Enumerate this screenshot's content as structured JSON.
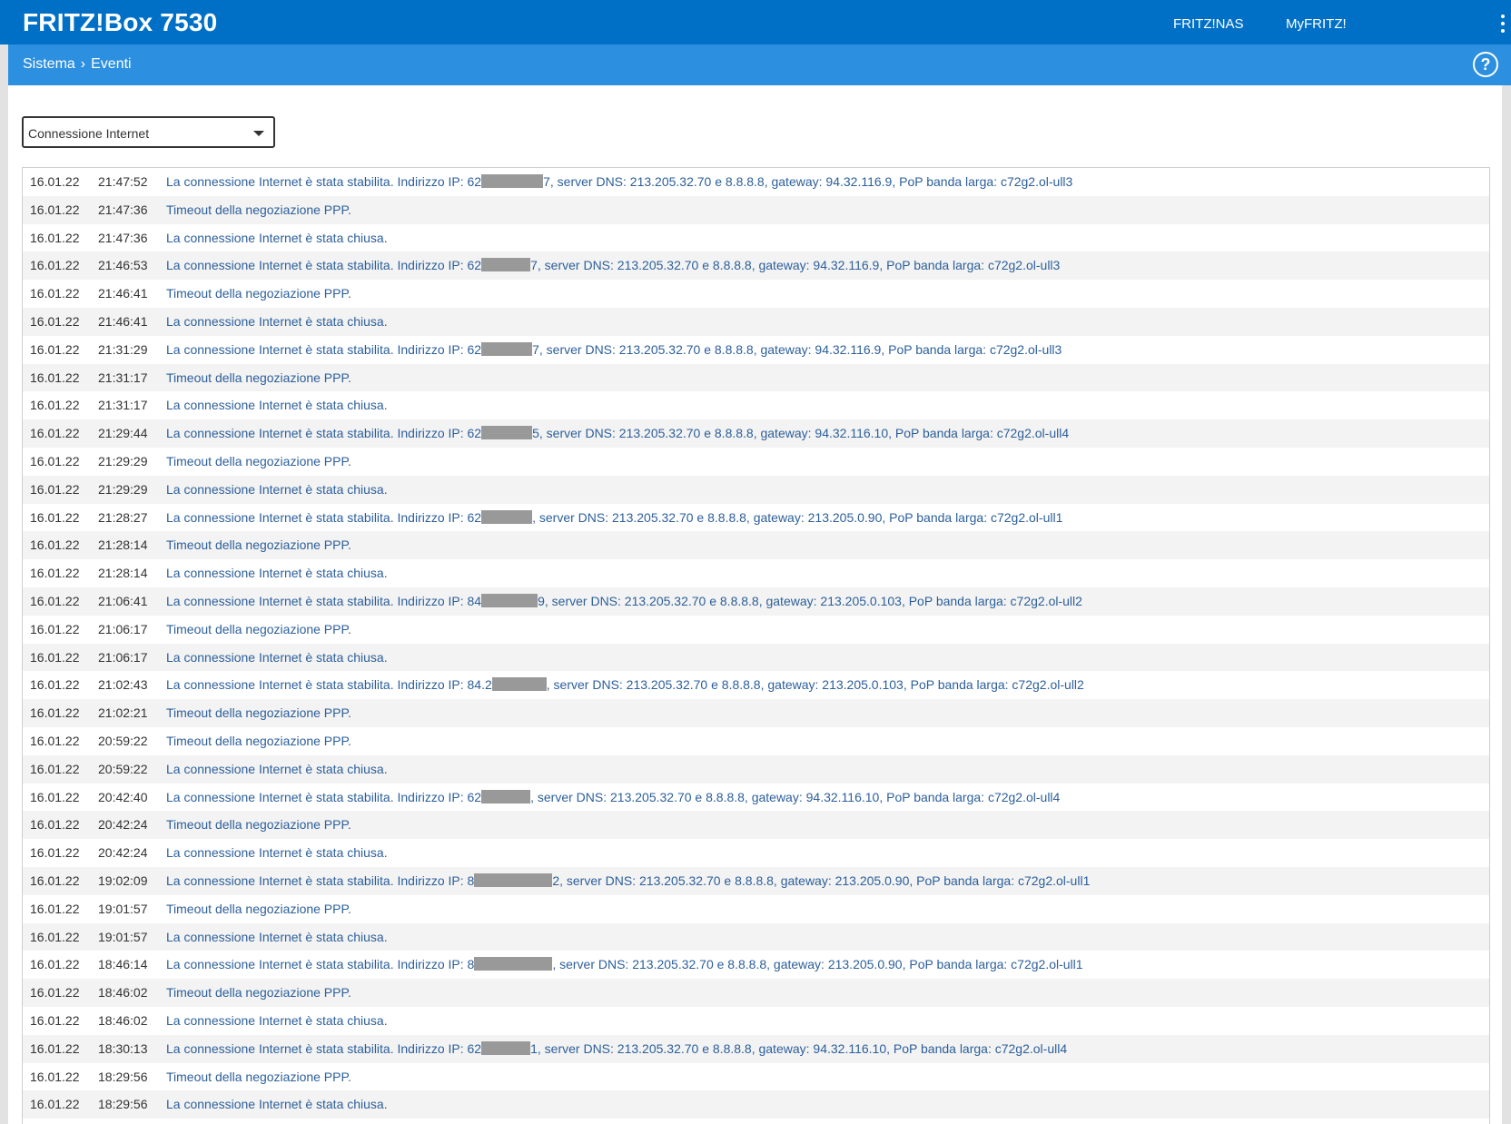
{
  "header": {
    "title": "FRITZ!Box 7530",
    "links": [
      "FRITZ!NAS",
      "MyFRITZ!"
    ]
  },
  "breadcrumb": {
    "section": "Sistema",
    "page": "Eventi",
    "help": "?"
  },
  "filter": {
    "selected": "Connessione Internet"
  },
  "events": [
    {
      "date": "16.01.22",
      "time": "21:47:52",
      "pre": "La connessione Internet è stata stabilita. Indirizzo IP: 62",
      "post": "7, server DNS: 213.205.32.70 e 8.8.8.8, gateway: 94.32.116.9, PoP banda larga: c72g2.ol-ull3"
    },
    {
      "date": "16.01.22",
      "time": "21:47:36",
      "pre": "Timeout della negoziazione PPP.",
      "post": ""
    },
    {
      "date": "16.01.22",
      "time": "21:47:36",
      "pre": "La connessione Internet è stata chiusa.",
      "post": ""
    },
    {
      "date": "16.01.22",
      "time": "21:46:53",
      "pre": "La connessione Internet è stata stabilita. Indirizzo IP: 62",
      "post": "7, server DNS: 213.205.32.70 e 8.8.8.8, gateway: 94.32.116.9, PoP banda larga: c72g2.ol-ull3"
    },
    {
      "date": "16.01.22",
      "time": "21:46:41",
      "pre": "Timeout della negoziazione PPP.",
      "post": ""
    },
    {
      "date": "16.01.22",
      "time": "21:46:41",
      "pre": "La connessione Internet è stata chiusa.",
      "post": ""
    },
    {
      "date": "16.01.22",
      "time": "21:31:29",
      "pre": "La connessione Internet è stata stabilita. Indirizzo IP: 62",
      "post": "7, server DNS: 213.205.32.70 e 8.8.8.8, gateway: 94.32.116.9, PoP banda larga: c72g2.ol-ull3"
    },
    {
      "date": "16.01.22",
      "time": "21:31:17",
      "pre": "Timeout della negoziazione PPP.",
      "post": ""
    },
    {
      "date": "16.01.22",
      "time": "21:31:17",
      "pre": "La connessione Internet è stata chiusa.",
      "post": ""
    },
    {
      "date": "16.01.22",
      "time": "21:29:44",
      "pre": "La connessione Internet è stata stabilita. Indirizzo IP: 62",
      "post": "5, server DNS: 213.205.32.70 e 8.8.8.8, gateway: 94.32.116.10, PoP banda larga: c72g2.ol-ull4"
    },
    {
      "date": "16.01.22",
      "time": "21:29:29",
      "pre": "Timeout della negoziazione PPP.",
      "post": ""
    },
    {
      "date": "16.01.22",
      "time": "21:29:29",
      "pre": "La connessione Internet è stata chiusa.",
      "post": ""
    },
    {
      "date": "16.01.22",
      "time": "21:28:27",
      "pre": "La connessione Internet è stata stabilita. Indirizzo IP: 62",
      "post": ", server DNS: 213.205.32.70 e 8.8.8.8, gateway: 213.205.0.90, PoP banda larga: c72g2.ol-ull1"
    },
    {
      "date": "16.01.22",
      "time": "21:28:14",
      "pre": "Timeout della negoziazione PPP.",
      "post": ""
    },
    {
      "date": "16.01.22",
      "time": "21:28:14",
      "pre": "La connessione Internet è stata chiusa.",
      "post": ""
    },
    {
      "date": "16.01.22",
      "time": "21:06:41",
      "pre": "La connessione Internet è stata stabilita. Indirizzo IP: 84",
      "post": "9, server DNS: 213.205.32.70 e 8.8.8.8, gateway: 213.205.0.103, PoP banda larga: c72g2.ol-ull2"
    },
    {
      "date": "16.01.22",
      "time": "21:06:17",
      "pre": "Timeout della negoziazione PPP.",
      "post": ""
    },
    {
      "date": "16.01.22",
      "time": "21:06:17",
      "pre": "La connessione Internet è stata chiusa.",
      "post": ""
    },
    {
      "date": "16.01.22",
      "time": "21:02:43",
      "pre": "La connessione Internet è stata stabilita. Indirizzo IP: 84.2",
      "post": ", server DNS: 213.205.32.70 e 8.8.8.8, gateway: 213.205.0.103, PoP banda larga: c72g2.ol-ull2"
    },
    {
      "date": "16.01.22",
      "time": "21:02:21",
      "pre": "Timeout della negoziazione PPP.",
      "post": ""
    },
    {
      "date": "16.01.22",
      "time": "20:59:22",
      "pre": "Timeout della negoziazione PPP.",
      "post": ""
    },
    {
      "date": "16.01.22",
      "time": "20:59:22",
      "pre": "La connessione Internet è stata chiusa.",
      "post": ""
    },
    {
      "date": "16.01.22",
      "time": "20:42:40",
      "pre": "La connessione Internet è stata stabilita. Indirizzo IP: 62",
      "post": ", server DNS: 213.205.32.70 e 8.8.8.8, gateway: 94.32.116.10, PoP banda larga: c72g2.ol-ull4"
    },
    {
      "date": "16.01.22",
      "time": "20:42:24",
      "pre": "Timeout della negoziazione PPP.",
      "post": ""
    },
    {
      "date": "16.01.22",
      "time": "20:42:24",
      "pre": "La connessione Internet è stata chiusa.",
      "post": ""
    },
    {
      "date": "16.01.22",
      "time": "19:02:09",
      "pre": "La connessione Internet è stata stabilita. Indirizzo IP: 8",
      "post": "2, server DNS: 213.205.32.70 e 8.8.8.8, gateway: 213.205.0.90, PoP banda larga: c72g2.ol-ull1"
    },
    {
      "date": "16.01.22",
      "time": "19:01:57",
      "pre": "Timeout della negoziazione PPP.",
      "post": ""
    },
    {
      "date": "16.01.22",
      "time": "19:01:57",
      "pre": "La connessione Internet è stata chiusa.",
      "post": ""
    },
    {
      "date": "16.01.22",
      "time": "18:46:14",
      "pre": "La connessione Internet è stata stabilita. Indirizzo IP: 8",
      "post": ", server DNS: 213.205.32.70 e 8.8.8.8, gateway: 213.205.0.90, PoP banda larga: c72g2.ol-ull1"
    },
    {
      "date": "16.01.22",
      "time": "18:46:02",
      "pre": "Timeout della negoziazione PPP.",
      "post": ""
    },
    {
      "date": "16.01.22",
      "time": "18:46:02",
      "pre": "La connessione Internet è stata chiusa.",
      "post": ""
    },
    {
      "date": "16.01.22",
      "time": "18:30:13",
      "pre": "La connessione Internet è stata stabilita. Indirizzo IP: 62",
      "post": "1, server DNS: 213.205.32.70 e 8.8.8.8, gateway: 94.32.116.10, PoP banda larga: c72g2.ol-ull4"
    },
    {
      "date": "16.01.22",
      "time": "18:29:56",
      "pre": "Timeout della negoziazione PPP.",
      "post": ""
    },
    {
      "date": "16.01.22",
      "time": "18:29:56",
      "pre": "La connessione Internet è stata chiusa.",
      "post": ""
    }
  ]
}
